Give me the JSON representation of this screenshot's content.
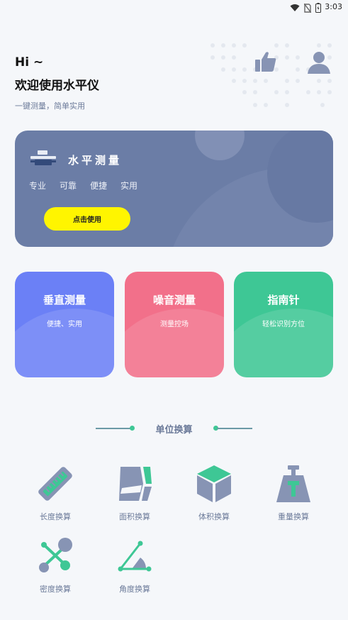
{
  "status_bar": {
    "time": "3:03"
  },
  "greeting": {
    "hi": "Hi ~",
    "title": "欢迎使用水平仪",
    "subtitle": "一键测量，简单实用"
  },
  "hero": {
    "title": "水平测量",
    "tags": [
      "专业",
      "可靠",
      "便捷",
      "实用"
    ],
    "button_label": "点击使用",
    "colors": {
      "background": "#6b7da6",
      "button": "#fff500"
    }
  },
  "feature_cards": [
    {
      "title": "垂直测量",
      "subtitle": "便捷、实用",
      "color": "#6b80f6"
    },
    {
      "title": "噪音测量",
      "subtitle": "测量控场",
      "color": "#f2708a"
    },
    {
      "title": "指南针",
      "subtitle": "轻松识别方位",
      "color": "#3ec795"
    }
  ],
  "section": {
    "title": "单位换算"
  },
  "tools": [
    {
      "label": "长度换算",
      "icon": "ruler-icon"
    },
    {
      "label": "面积换算",
      "icon": "area-icon"
    },
    {
      "label": "体积换算",
      "icon": "cube-icon"
    },
    {
      "label": "重量换算",
      "icon": "weight-icon"
    },
    {
      "label": "密度换算",
      "icon": "density-icon"
    },
    {
      "label": "角度换算",
      "icon": "angle-icon"
    }
  ],
  "icons": {
    "like": "thumbs-up-icon",
    "profile": "user-icon"
  },
  "accent_colors": {
    "primary_text": "#6b7a99",
    "icon_gray": "#8794b4",
    "green": "#3ec795"
  }
}
